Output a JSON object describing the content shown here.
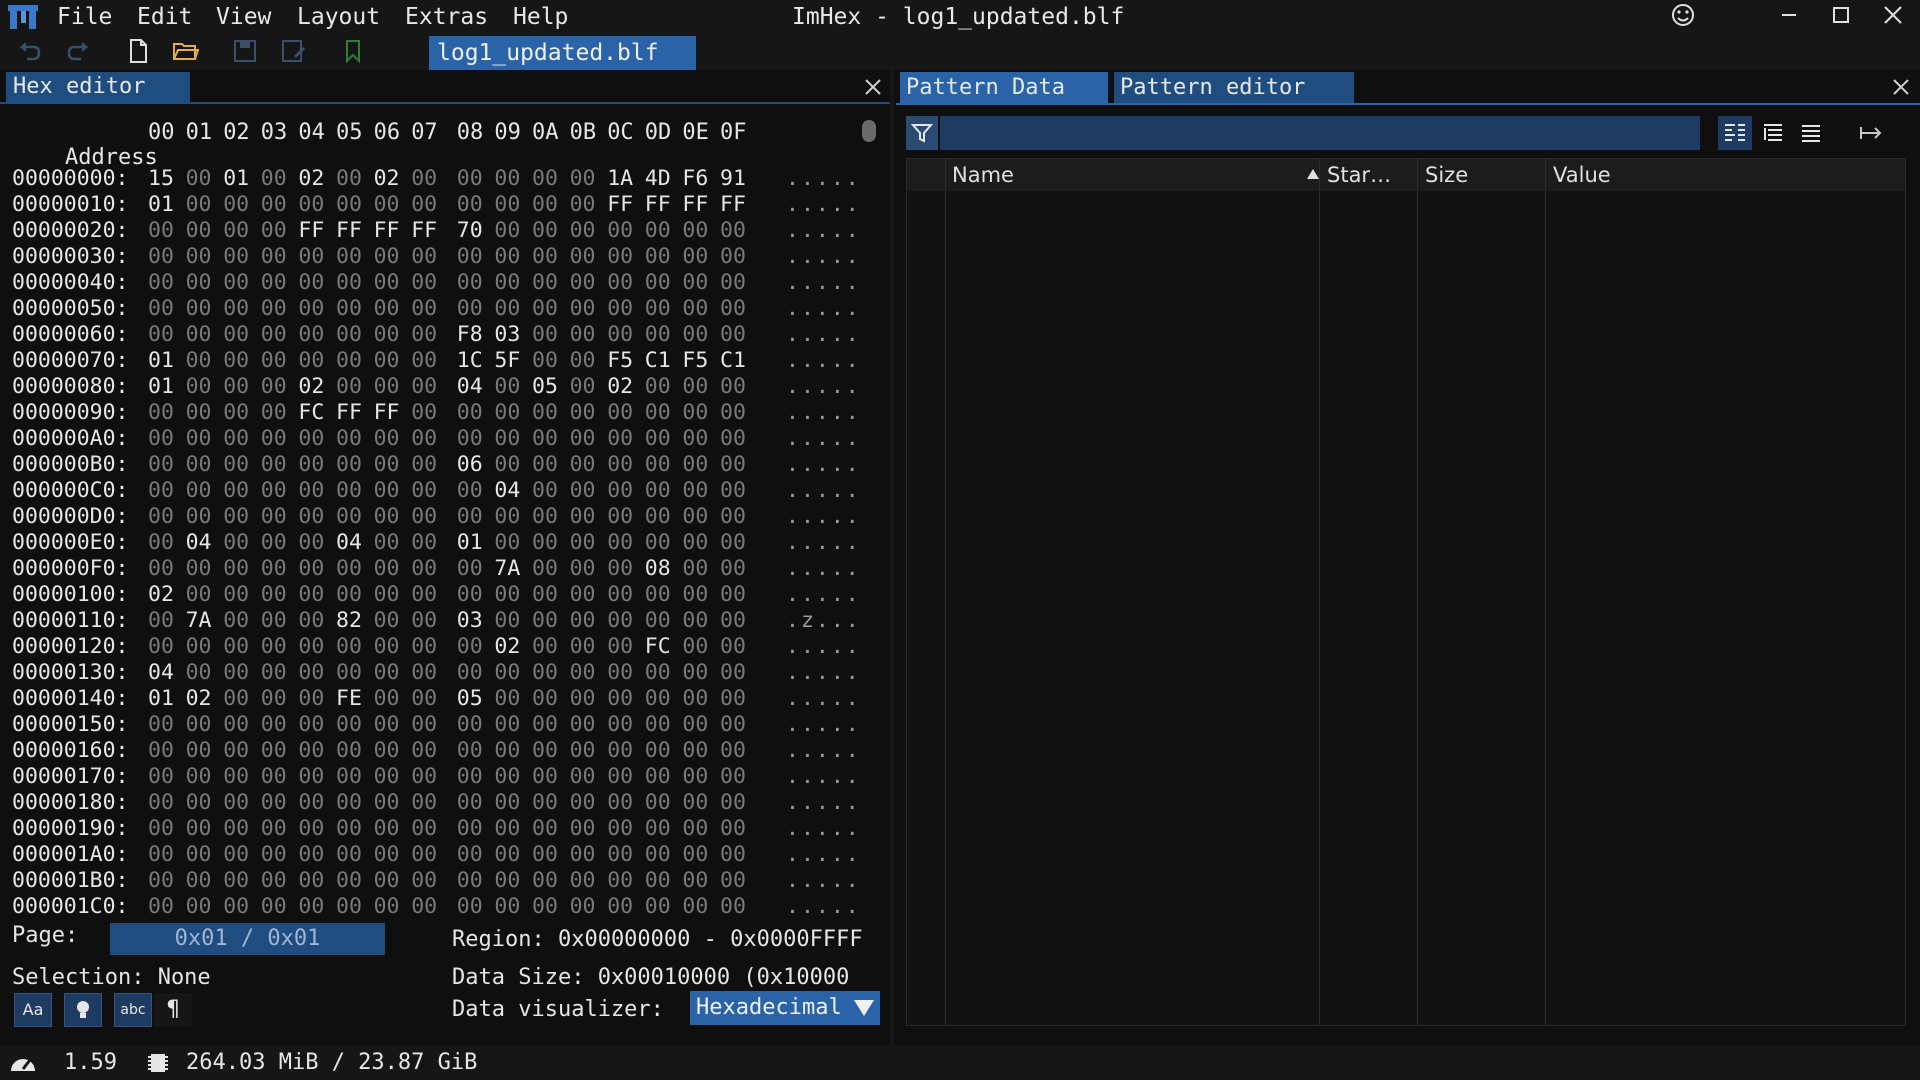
{
  "app": {
    "title": "ImHex - log1_updated.blf",
    "menu": [
      "File",
      "Edit",
      "View",
      "Layout",
      "Extras",
      "Help"
    ],
    "open_file_tab": "log1_updated.blf",
    "accent": "#2a63a8"
  },
  "hex_editor": {
    "tab_label": "Hex editor",
    "header_address": "Address",
    "header_offsets": [
      "00",
      "01",
      "02",
      "03",
      "04",
      "05",
      "06",
      "07",
      "08",
      "09",
      "0A",
      "0B",
      "0C",
      "0D",
      "0E",
      "0F"
    ],
    "rows": [
      {
        "addr": "00000000:",
        "bytes": [
          "15",
          "00",
          "01",
          "00",
          "02",
          "00",
          "02",
          "00",
          "00",
          "00",
          "00",
          "00",
          "1A",
          "4D",
          "F6",
          "91"
        ],
        "ascii": "....."
      },
      {
        "addr": "00000010:",
        "bytes": [
          "01",
          "00",
          "00",
          "00",
          "00",
          "00",
          "00",
          "00",
          "00",
          "00",
          "00",
          "00",
          "FF",
          "FF",
          "FF",
          "FF"
        ],
        "ascii": "....."
      },
      {
        "addr": "00000020:",
        "bytes": [
          "00",
          "00",
          "00",
          "00",
          "FF",
          "FF",
          "FF",
          "FF",
          "70",
          "00",
          "00",
          "00",
          "00",
          "00",
          "00",
          "00"
        ],
        "ascii": "....."
      },
      {
        "addr": "00000030:",
        "bytes": [
          "00",
          "00",
          "00",
          "00",
          "00",
          "00",
          "00",
          "00",
          "00",
          "00",
          "00",
          "00",
          "00",
          "00",
          "00",
          "00"
        ],
        "ascii": "....."
      },
      {
        "addr": "00000040:",
        "bytes": [
          "00",
          "00",
          "00",
          "00",
          "00",
          "00",
          "00",
          "00",
          "00",
          "00",
          "00",
          "00",
          "00",
          "00",
          "00",
          "00"
        ],
        "ascii": "....."
      },
      {
        "addr": "00000050:",
        "bytes": [
          "00",
          "00",
          "00",
          "00",
          "00",
          "00",
          "00",
          "00",
          "00",
          "00",
          "00",
          "00",
          "00",
          "00",
          "00",
          "00"
        ],
        "ascii": "....."
      },
      {
        "addr": "00000060:",
        "bytes": [
          "00",
          "00",
          "00",
          "00",
          "00",
          "00",
          "00",
          "00",
          "F8",
          "03",
          "00",
          "00",
          "00",
          "00",
          "00",
          "00"
        ],
        "ascii": "....."
      },
      {
        "addr": "00000070:",
        "bytes": [
          "01",
          "00",
          "00",
          "00",
          "00",
          "00",
          "00",
          "00",
          "1C",
          "5F",
          "00",
          "00",
          "F5",
          "C1",
          "F5",
          "C1"
        ],
        "ascii": "....."
      },
      {
        "addr": "00000080:",
        "bytes": [
          "01",
          "00",
          "00",
          "00",
          "02",
          "00",
          "00",
          "00",
          "04",
          "00",
          "05",
          "00",
          "02",
          "00",
          "00",
          "00"
        ],
        "ascii": "....."
      },
      {
        "addr": "00000090:",
        "bytes": [
          "00",
          "00",
          "00",
          "00",
          "FC",
          "FF",
          "FF",
          "00",
          "00",
          "00",
          "00",
          "00",
          "00",
          "00",
          "00",
          "00"
        ],
        "ascii": "....."
      },
      {
        "addr": "000000A0:",
        "bytes": [
          "00",
          "00",
          "00",
          "00",
          "00",
          "00",
          "00",
          "00",
          "00",
          "00",
          "00",
          "00",
          "00",
          "00",
          "00",
          "00"
        ],
        "ascii": "....."
      },
      {
        "addr": "000000B0:",
        "bytes": [
          "00",
          "00",
          "00",
          "00",
          "00",
          "00",
          "00",
          "00",
          "06",
          "00",
          "00",
          "00",
          "00",
          "00",
          "00",
          "00"
        ],
        "ascii": "....."
      },
      {
        "addr": "000000C0:",
        "bytes": [
          "00",
          "00",
          "00",
          "00",
          "00",
          "00",
          "00",
          "00",
          "00",
          "04",
          "00",
          "00",
          "00",
          "00",
          "00",
          "00"
        ],
        "ascii": "....."
      },
      {
        "addr": "000000D0:",
        "bytes": [
          "00",
          "00",
          "00",
          "00",
          "00",
          "00",
          "00",
          "00",
          "00",
          "00",
          "00",
          "00",
          "00",
          "00",
          "00",
          "00"
        ],
        "ascii": "....."
      },
      {
        "addr": "000000E0:",
        "bytes": [
          "00",
          "04",
          "00",
          "00",
          "00",
          "04",
          "00",
          "00",
          "01",
          "00",
          "00",
          "00",
          "00",
          "00",
          "00",
          "00"
        ],
        "ascii": "....."
      },
      {
        "addr": "000000F0:",
        "bytes": [
          "00",
          "00",
          "00",
          "00",
          "00",
          "00",
          "00",
          "00",
          "00",
          "7A",
          "00",
          "00",
          "00",
          "08",
          "00",
          "00"
        ],
        "ascii": "....."
      },
      {
        "addr": "00000100:",
        "bytes": [
          "02",
          "00",
          "00",
          "00",
          "00",
          "00",
          "00",
          "00",
          "00",
          "00",
          "00",
          "00",
          "00",
          "00",
          "00",
          "00"
        ],
        "ascii": "....."
      },
      {
        "addr": "00000110:",
        "bytes": [
          "00",
          "7A",
          "00",
          "00",
          "00",
          "82",
          "00",
          "00",
          "03",
          "00",
          "00",
          "00",
          "00",
          "00",
          "00",
          "00"
        ],
        "ascii": ".z..."
      },
      {
        "addr": "00000120:",
        "bytes": [
          "00",
          "00",
          "00",
          "00",
          "00",
          "00",
          "00",
          "00",
          "00",
          "02",
          "00",
          "00",
          "00",
          "FC",
          "00",
          "00"
        ],
        "ascii": "....."
      },
      {
        "addr": "00000130:",
        "bytes": [
          "04",
          "00",
          "00",
          "00",
          "00",
          "00",
          "00",
          "00",
          "00",
          "00",
          "00",
          "00",
          "00",
          "00",
          "00",
          "00"
        ],
        "ascii": "....."
      },
      {
        "addr": "00000140:",
        "bytes": [
          "01",
          "02",
          "00",
          "00",
          "00",
          "FE",
          "00",
          "00",
          "05",
          "00",
          "00",
          "00",
          "00",
          "00",
          "00",
          "00"
        ],
        "ascii": "....."
      },
      {
        "addr": "00000150:",
        "bytes": [
          "00",
          "00",
          "00",
          "00",
          "00",
          "00",
          "00",
          "00",
          "00",
          "00",
          "00",
          "00",
          "00",
          "00",
          "00",
          "00"
        ],
        "ascii": "....."
      },
      {
        "addr": "00000160:",
        "bytes": [
          "00",
          "00",
          "00",
          "00",
          "00",
          "00",
          "00",
          "00",
          "00",
          "00",
          "00",
          "00",
          "00",
          "00",
          "00",
          "00"
        ],
        "ascii": "....."
      },
      {
        "addr": "00000170:",
        "bytes": [
          "00",
          "00",
          "00",
          "00",
          "00",
          "00",
          "00",
          "00",
          "00",
          "00",
          "00",
          "00",
          "00",
          "00",
          "00",
          "00"
        ],
        "ascii": "....."
      },
      {
        "addr": "00000180:",
        "bytes": [
          "00",
          "00",
          "00",
          "00",
          "00",
          "00",
          "00",
          "00",
          "00",
          "00",
          "00",
          "00",
          "00",
          "00",
          "00",
          "00"
        ],
        "ascii": "....."
      },
      {
        "addr": "00000190:",
        "bytes": [
          "00",
          "00",
          "00",
          "00",
          "00",
          "00",
          "00",
          "00",
          "00",
          "00",
          "00",
          "00",
          "00",
          "00",
          "00",
          "00"
        ],
        "ascii": "....."
      },
      {
        "addr": "000001A0:",
        "bytes": [
          "00",
          "00",
          "00",
          "00",
          "00",
          "00",
          "00",
          "00",
          "00",
          "00",
          "00",
          "00",
          "00",
          "00",
          "00",
          "00"
        ],
        "ascii": "....."
      },
      {
        "addr": "000001B0:",
        "bytes": [
          "00",
          "00",
          "00",
          "00",
          "00",
          "00",
          "00",
          "00",
          "00",
          "00",
          "00",
          "00",
          "00",
          "00",
          "00",
          "00"
        ],
        "ascii": "....."
      },
      {
        "addr": "000001C0:",
        "bytes": [
          "00",
          "00",
          "00",
          "00",
          "00",
          "00",
          "00",
          "00",
          "00",
          "00",
          "00",
          "00",
          "00",
          "00",
          "00",
          "00"
        ],
        "ascii": "....."
      }
    ],
    "footer": {
      "page_label": "Page:",
      "page_value": "0x01 / 0x01",
      "region_text": "Region: 0x00000000 - 0x0000FFFF",
      "selection_text": "Selection: None",
      "data_size_text": "Data Size: 0x00010000 (0x10000",
      "visualizer_label": "Data visualizer:",
      "visualizer_value": "Hexadecimal",
      "buttons": [
        "Aa",
        "",
        "abc",
        "¶"
      ]
    }
  },
  "pattern": {
    "tabs": [
      "Pattern Data",
      "Pattern editor"
    ],
    "filter_placeholder": "",
    "columns": [
      "Name",
      "Star…",
      "Size",
      "Value"
    ]
  },
  "status": {
    "fps": "1.59",
    "memory": "264.03 MiB / 23.87 GiB"
  }
}
